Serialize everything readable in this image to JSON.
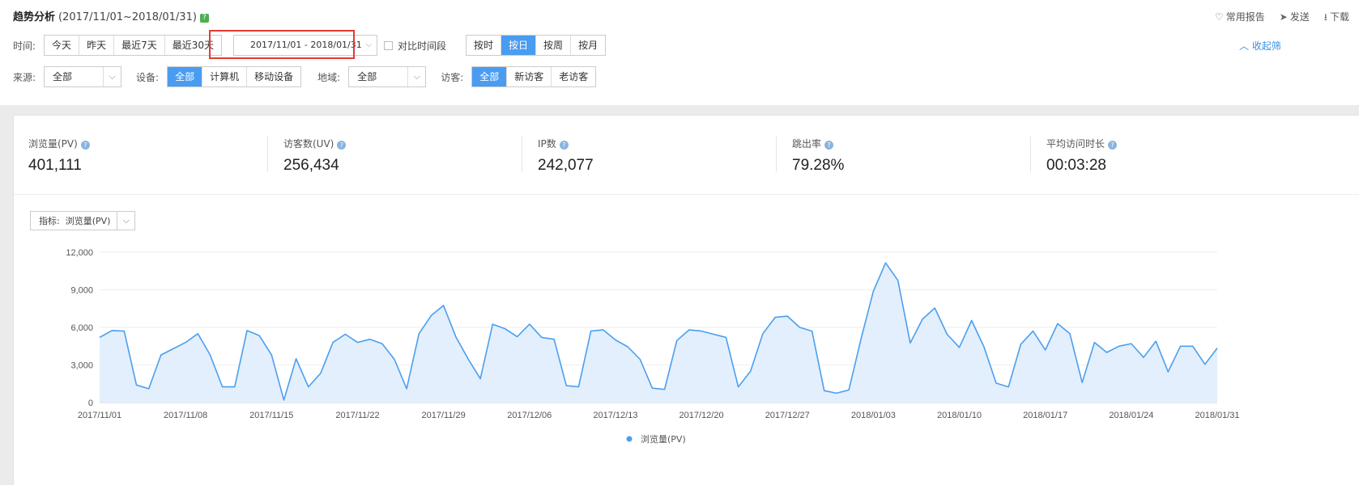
{
  "header": {
    "title": "趋势分析",
    "range": "(2017/11/01~2018/01/31)",
    "help_icon": "?",
    "actions": [
      {
        "icon": "heart-icon",
        "glyph": "♡",
        "label": "常用报告"
      },
      {
        "icon": "send-icon",
        "glyph": "➤",
        "label": "发送"
      },
      {
        "icon": "download-icon",
        "glyph": "⭳",
        "label": "下载"
      }
    ],
    "collapse_label": "收起筛"
  },
  "filters": {
    "time_label": "时间:",
    "time_presets": [
      "今天",
      "昨天",
      "最近7天",
      "最近30天"
    ],
    "date_range": "2017/11/01 - 2018/01/31",
    "compare_label": "对比时间段",
    "granularity": [
      {
        "label": "按时",
        "active": false
      },
      {
        "label": "按日",
        "active": true
      },
      {
        "label": "按周",
        "active": false
      },
      {
        "label": "按月",
        "active": false
      }
    ],
    "source_label": "来源:",
    "source_value": "全部",
    "device_label": "设备:",
    "devices": [
      {
        "label": "全部",
        "active": true
      },
      {
        "label": "计算机",
        "active": false
      },
      {
        "label": "移动设备",
        "active": false
      }
    ],
    "region_label": "地域:",
    "region_value": "全部",
    "visitor_label": "访客:",
    "visitors": [
      {
        "label": "全部",
        "active": true
      },
      {
        "label": "新访客",
        "active": false
      },
      {
        "label": "老访客",
        "active": false
      }
    ]
  },
  "metrics": [
    {
      "name": "浏览量(PV)",
      "value": "401,111"
    },
    {
      "name": "访客数(UV)",
      "value": "256,434"
    },
    {
      "name": "IP数",
      "value": "242,077"
    },
    {
      "name": "跳出率",
      "value": "79.28%"
    },
    {
      "name": "平均访问时长",
      "value": "00:03:28"
    }
  ],
  "indicator": {
    "label": "指标:",
    "value": "浏览量(PV)"
  },
  "chart_data": {
    "type": "area",
    "series": [
      {
        "name": "浏览量(PV)",
        "color": "#4a9ff0"
      }
    ],
    "ylim": [
      0,
      12000
    ],
    "y_ticks": [
      "0",
      "3,000",
      "6,000",
      "9,000",
      "12,000"
    ],
    "x_tick_labels": [
      "2017/11/01",
      "2017/11/08",
      "2017/11/15",
      "2017/11/22",
      "2017/11/29",
      "2017/12/06",
      "2017/12/13",
      "2017/12/20",
      "2017/12/27",
      "2018/01/03",
      "2018/01/10",
      "2018/01/17",
      "2018/01/24",
      "2018/01/31"
    ],
    "grid": true,
    "legend": "bottom-center",
    "values": [
      5200,
      5750,
      5700,
      1400,
      1100,
      3800,
      4300,
      4800,
      5500,
      3800,
      1250,
      1250,
      5750,
      5350,
      3800,
      200,
      3500,
      1250,
      2350,
      4800,
      5450,
      4800,
      5050,
      4700,
      3450,
      1100,
      5500,
      6950,
      7750,
      5250,
      3500,
      1900,
      6250,
      5900,
      5250,
      6250,
      5200,
      5050,
      1350,
      1250,
      5700,
      5800,
      5000,
      4450,
      3450,
      1150,
      1050,
      4950,
      5800,
      5700,
      5450,
      5200,
      1250,
      2500,
      5500,
      6800,
      6900,
      6000,
      5700,
      950,
      750,
      1000,
      5100,
      8900,
      11150,
      9750,
      4750,
      6650,
      7550,
      5450,
      4400,
      6550,
      4450,
      1550,
      1250,
      4650,
      5700,
      4200,
      6300,
      5500,
      1600,
      4800,
      4000,
      4500,
      4700,
      3600,
      4900,
      2450,
      4500,
      4500,
      3050,
      4350
    ]
  }
}
